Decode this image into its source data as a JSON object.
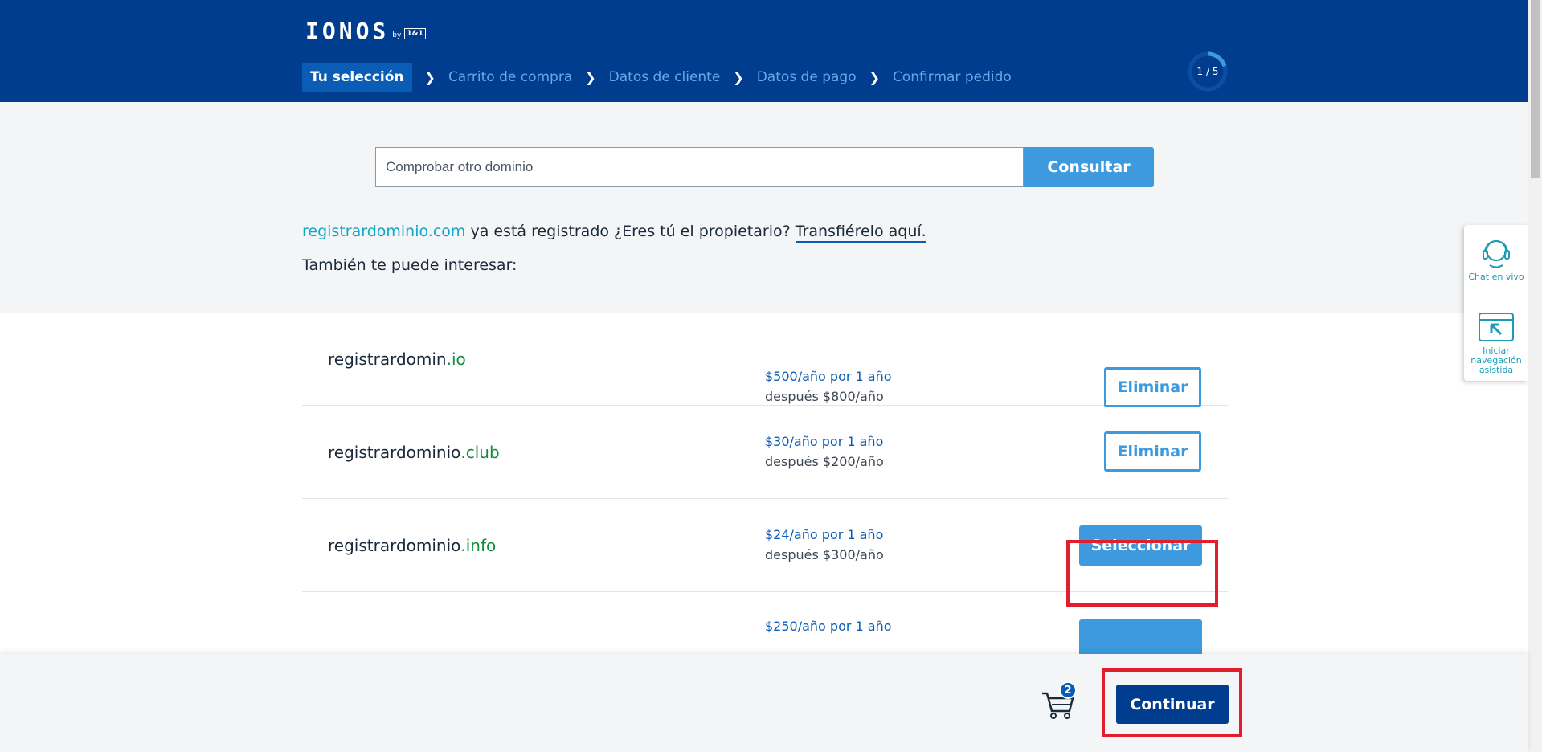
{
  "header": {
    "logo_text": "IONOS",
    "logo_by": "by",
    "logo_badge": "1&1",
    "steps": [
      {
        "label": "Tu selección"
      },
      {
        "label": "Carrito de compra"
      },
      {
        "label": "Datos de cliente"
      },
      {
        "label": "Datos de pago"
      },
      {
        "label": "Confirmar pedido"
      }
    ],
    "progress": {
      "text": "1 / 5",
      "current": 1,
      "total": 5
    }
  },
  "search": {
    "placeholder": "Comprobar otro dominio",
    "button_label": "Consultar"
  },
  "info": {
    "domain": "registrardominio.com",
    "message": " ya está registrado ¿Eres tú el propietario? ",
    "transfer_link": "Transfiérelo aquí.",
    "also_interested": "También te puede interesar:"
  },
  "domains": [
    {
      "name": "registrardomin",
      "tld": ".io",
      "price": "$500/año por 1 año",
      "after": "después $800/año",
      "action": "Eliminar"
    },
    {
      "name": "registrardominio",
      "tld": ".club",
      "price": "$30/año por 1 año",
      "after": "después $200/año",
      "action": "Eliminar"
    },
    {
      "name": "registrardominio",
      "tld": ".info",
      "price": "$24/año por 1 año",
      "after": "después $300/año",
      "action": "Seleccionar"
    },
    {
      "name": "",
      "tld": "",
      "price": "$250/año por 1 año",
      "after": "",
      "action": ""
    }
  ],
  "side_widget": {
    "chat_label": "Chat en vivo",
    "assist_label": "Iniciar navegación asistida"
  },
  "footer": {
    "cart_count": "2",
    "continue_label": "Continuar"
  },
  "colors": {
    "header_bg": "#003d8f",
    "accent": "#3d9ade",
    "tld_green": "#138a3e",
    "highlight_red": "#e01e2e"
  }
}
